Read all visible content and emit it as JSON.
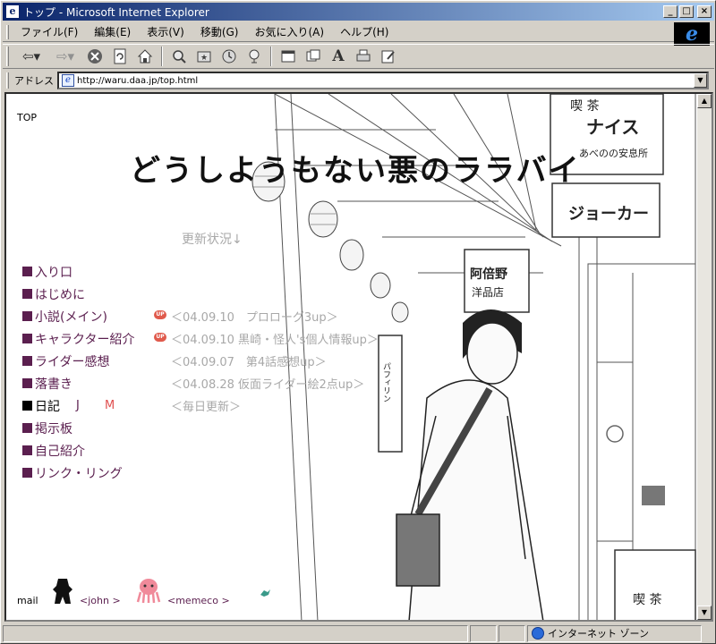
{
  "window": {
    "title": "トップ - Microsoft Internet Explorer",
    "app_icon": "ie-page-icon",
    "controls": {
      "minimize": "_",
      "maximize": "□",
      "close": "×"
    }
  },
  "menu": [
    "ファイル(F)",
    "編集(E)",
    "表示(V)",
    "移動(G)",
    "お気に入り(A)",
    "ヘルプ(H)"
  ],
  "toolbar": [
    "back-icon",
    "forward-icon",
    "stop-icon",
    "refresh-icon",
    "home-icon",
    "search-icon",
    "favorites-icon",
    "history-icon",
    "channels-icon",
    "fullscreen-icon",
    "mail-icon",
    "font-icon",
    "print-icon",
    "edit-icon"
  ],
  "address": {
    "label": "アドレス",
    "url": "http://waru.daa.jp/top.html"
  },
  "page": {
    "label": "TOP",
    "title": "どうしようもない悪のララバイ",
    "update_heading": "更新状況↓",
    "nav": [
      {
        "label": "入り口"
      },
      {
        "label": "はじめに"
      },
      {
        "label": "小説(メイン)",
        "badge": "UP",
        "update": "＜04.09.10　プロローグ3up＞"
      },
      {
        "label": "キャラクター紹介",
        "badge": "UP",
        "update": "＜04.09.10 黒崎・怪人's個人情報up＞"
      },
      {
        "label": "ライダー感想",
        "update": "＜04.09.07　第4話感想up＞"
      },
      {
        "label": "落書き",
        "update": "＜04.08.28 仮面ライダー絵2点up＞"
      },
      {
        "label": "日記",
        "sub_j": "J",
        "sub_m": "M",
        "update": "＜毎日更新＞"
      },
      {
        "label": "掲示板"
      },
      {
        "label": "自己紹介"
      },
      {
        "label": "リンク・リング"
      }
    ],
    "footer": {
      "mail": "mail",
      "link1": "<john >",
      "link2": "<memeco >"
    }
  },
  "status": {
    "zone": "インターネット ゾーン"
  },
  "colors": {
    "link": "#5b1f4f",
    "update": "#a8a8a8",
    "titlebar": "#0a246a"
  }
}
